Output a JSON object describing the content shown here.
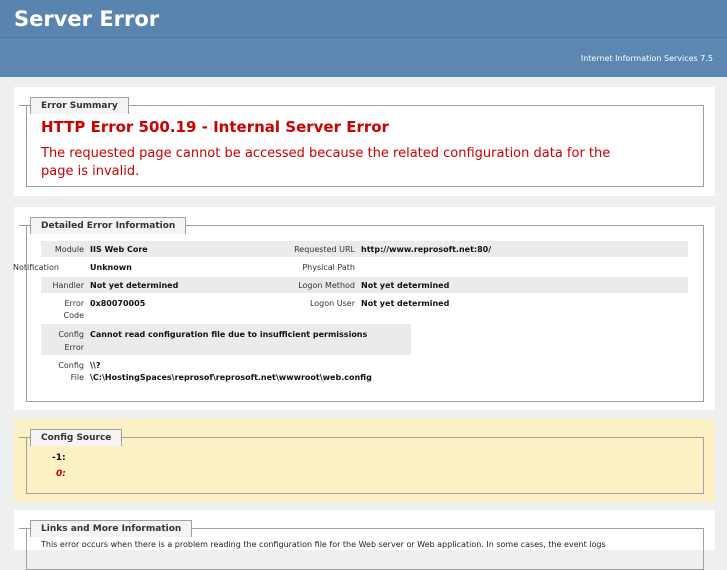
{
  "header": {
    "title": "Server Error",
    "subtitle": "Internet Information Services 7.5"
  },
  "summary": {
    "legend": "Error Summary",
    "heading": "HTTP Error 500.19 - Internal Server Error",
    "message_line1": "The requested page cannot be accessed because the related configuration data for the",
    "message_line2": "page is invalid."
  },
  "details": {
    "legend": "Detailed Error Information",
    "module_label": "Module",
    "module_value": "IIS Web Core",
    "notification_label": "Notification",
    "notification_value": "Unknown",
    "handler_label": "Handler",
    "handler_value": "Not yet determined",
    "error_code_label_1": "Error",
    "error_code_label_2": "Code",
    "error_code_value": "0x80070005",
    "config_error_label_1": "Config",
    "config_error_label_2": "Error",
    "config_error_value": "Cannot read configuration file due to insufficient permissions",
    "config_file_label_1": "Config",
    "config_file_label_2": "File",
    "config_file_value_1": "\\\\?",
    "config_file_value_2": "\\C:\\HostingSpaces\\reprosof\\reprosoft.net\\wwwroot\\web.config",
    "requested_url_label": "Requested URL",
    "requested_url_value": "http://www.reprosoft.net:80/",
    "physical_path_label": "Physical Path",
    "physical_path_value": "",
    "logon_method_label": "Logon Method",
    "logon_method_value": "Not yet determined",
    "logon_user_label": "Logon User",
    "logon_user_value": "Not yet determined"
  },
  "config_source": {
    "legend": "Config Source",
    "line1": "-1:",
    "line2": "0:"
  },
  "links": {
    "legend": "Links and More Information",
    "text": "This error occurs when there is a problem reading the configuration file for the Web server or Web application. In some cases, the event logs"
  }
}
